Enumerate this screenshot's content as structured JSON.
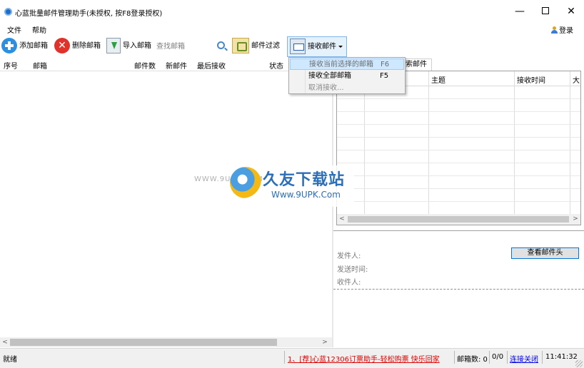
{
  "window": {
    "title": "心蓝批量邮件管理助手(未授权, 按F8登录授权)",
    "minimize": "—",
    "maximize": "",
    "close": "✕"
  },
  "menu": {
    "file": "文件",
    "help": "帮助",
    "login": "登录"
  },
  "toolbar": {
    "add_mailbox": "添加邮箱",
    "delete_mailbox": "删除邮箱",
    "import_mailbox": "导入邮箱",
    "search_placeholder": "查找邮箱",
    "mail_filter": "邮件过滤",
    "receive_mail": "接收邮件"
  },
  "receive_menu": {
    "items": [
      {
        "label": "接收当前选择的邮箱",
        "shortcut": "F6",
        "state": "highlighted"
      },
      {
        "label": "接收全部邮箱",
        "shortcut": "F5",
        "state": "enabled"
      },
      {
        "label": "取消接收...",
        "shortcut": "",
        "state": "disabled"
      }
    ]
  },
  "mailbox_grid": {
    "columns": [
      "序号",
      "邮箱",
      "邮件数",
      "新邮件",
      "最后接收",
      "状态"
    ],
    "rows": []
  },
  "mail_panel": {
    "tab_partial": "索邮件",
    "columns": [
      "主题",
      "接收时间",
      "大"
    ],
    "view_header_button": "查看邮件头",
    "from_label": "发件人:",
    "sent_time_label": "发送时间:",
    "to_label": "收件人:"
  },
  "watermark": {
    "small": "WWW.9UPK.COM",
    "title": "久友下载站",
    "url": "Www.9UPK.Com"
  },
  "status": {
    "ready": "就绪",
    "ad": "1、[荐]心蓝12306订票助手-轻松购票 快乐回家",
    "mailbox_count_label": "邮箱数: 0",
    "ratio": "0/0",
    "connection": "连接关闭",
    "time": "11:41:32"
  },
  "colors": {
    "accent": "#0078d7",
    "ad_text": "#e00000",
    "link": "#0000ee",
    "menu_highlight": "#cde8ff"
  }
}
